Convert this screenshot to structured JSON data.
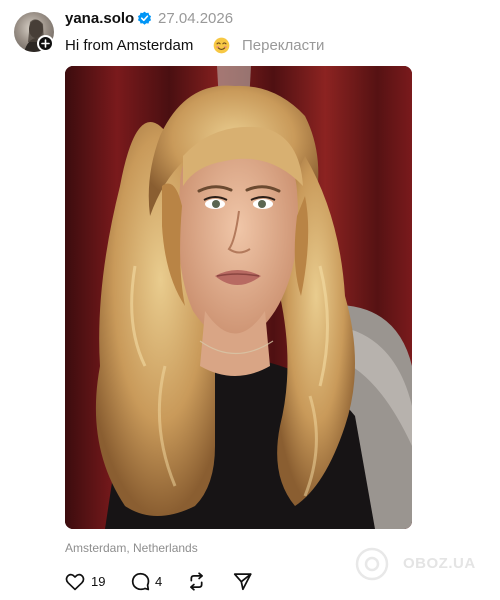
{
  "post": {
    "username": "yana.solo",
    "date": "27.04.2026",
    "caption": "Hi from Amsterdam",
    "caption_emoji": "smiling-face-emoji",
    "translate_label": "Перекласти",
    "image_icon": "selfie-photo",
    "location": "Amsterdam, Netherlands"
  },
  "actions": {
    "likes": "19",
    "replies": "4"
  },
  "icons": {
    "avatar": "avatar",
    "follow": "plus-icon",
    "verified": "verified-badge-icon",
    "like": "heart-icon",
    "reply": "comment-icon",
    "repost": "repost-icon",
    "share": "send-icon"
  },
  "watermark": {
    "text": "OBOZ.UA"
  },
  "colors": {
    "verified": "#0095f6",
    "secondary_text": "#999999",
    "primary_text": "#101010"
  }
}
